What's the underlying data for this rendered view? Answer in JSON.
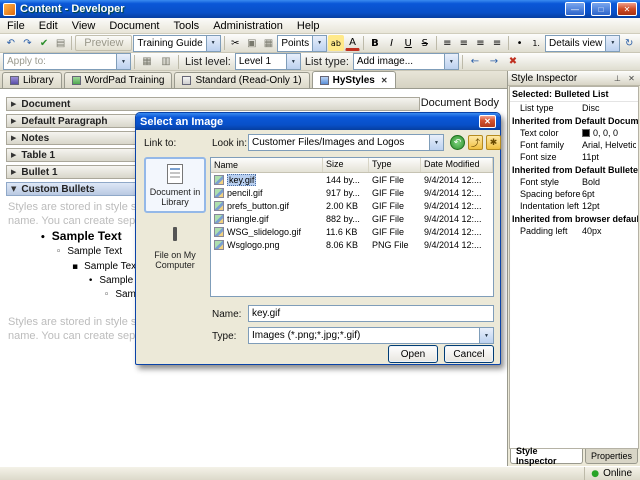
{
  "window": {
    "title": "Content - Developer",
    "status": "Online"
  },
  "menu": [
    "File",
    "Edit",
    "View",
    "Document",
    "Tools",
    "Administration",
    "Help"
  ],
  "icons": {
    "min": "—",
    "max": "□",
    "close": "✕",
    "undo": "↶",
    "redo": "↷",
    "check": "✔",
    "print": "▤",
    "cut": "✂",
    "copy": "▣",
    "paste": "▦",
    "highlight": "ab",
    "fontcolor": "A",
    "bold": "B",
    "italic": "I",
    "underline": "U",
    "strike": "S",
    "align": "≡",
    "bullets": "•",
    "numbering": "1.",
    "refresh": "↻",
    "image": "▦",
    "table": "▥",
    "outdent": "←",
    "indent": "→",
    "clear": "✖",
    "dropdown": "▼",
    "back": "↶",
    "folder_up": "⤴",
    "new_folder": "✱",
    "pin": "⊥",
    "arrow_right": "▶",
    "arrow_down": "▼",
    "dot": "●"
  },
  "toolbar": {
    "preview": "Preview",
    "style_combo": "Training Guide",
    "size_combo": "Points",
    "view_combo": "Details view",
    "apply_to": "Apply to:",
    "list_level_label": "List level:",
    "list_level": "Level 1",
    "list_type_label": "List type:",
    "list_type": "Add image..."
  },
  "tabs": [
    "Library",
    "WordPad Training",
    "Standard (Read-Only 1)",
    "HyStyles"
  ],
  "content": {
    "doc_body": "- Document Body",
    "sections": [
      "Document",
      "Default Paragraph",
      "Notes",
      "Table 1",
      "Bullet 1",
      "Custom Bullets"
    ],
    "gray1": "Styles are stored in style she",
    "gray2": "name. You can create separa",
    "markers": [
      "•",
      "◦",
      "▪",
      "•",
      "◦"
    ],
    "samples": [
      "Sample Text",
      "Sample Text",
      "Sample Text",
      "Sample Text",
      "Sample Text"
    ]
  },
  "dialog": {
    "title": "Select an Image",
    "link_to": "Link to:",
    "look_in_label": "Look in:",
    "look_in_value": "Customer Files/Images and Logos",
    "doc_in_library": "Document in Library",
    "file_on_computer": "File on My Computer",
    "columns": [
      "Name",
      "Size",
      "Type",
      "Date Modified"
    ],
    "files": [
      {
        "name": "key.gif",
        "size": "144 by...",
        "type": "GIF File",
        "modified": "9/4/2014 12:..."
      },
      {
        "name": "pencil.gif",
        "size": "917 by...",
        "type": "GIF File",
        "modified": "9/4/2014 12:..."
      },
      {
        "name": "prefs_button.gif",
        "size": "2.00 KB",
        "type": "GIF File",
        "modified": "9/4/2014 12:..."
      },
      {
        "name": "triangle.gif",
        "size": "882 by...",
        "type": "GIF File",
        "modified": "9/4/2014 12:..."
      },
      {
        "name": "WSG_slidelogo.gif",
        "size": "11.6 KB",
        "type": "GIF File",
        "modified": "9/4/2014 12:..."
      },
      {
        "name": "Wsglogo.png",
        "size": "8.06 KB",
        "type": "PNG File",
        "modified": "9/4/2014 12:..."
      }
    ],
    "name_label": "Name:",
    "name_value": "key.gif",
    "type_label": "Type:",
    "type_value": "Images (*.png;*.jpg;*.gif)",
    "open": "Open",
    "cancel": "Cancel"
  },
  "inspector": {
    "title": "Style Inspector",
    "selected": "Selected: Bulleted List",
    "list_type_label": "List type",
    "list_type_value": "Disc",
    "g1": "Inherited from Default Document",
    "text_color_label": "Text color",
    "text_color_value": "0, 0, 0",
    "font_family_label": "Font family",
    "font_family_value": "Arial, Helvetica,",
    "font_size_label": "Font size",
    "font_size_value": "11pt",
    "g2": "Inherited from Default Bulleted Li",
    "font_style_label": "Font style",
    "font_style_value": "Bold",
    "spacing_label": "Spacing before",
    "spacing_value": "6pt",
    "indent_label": "Indentation left",
    "indent_value": "12pt",
    "g3": "Inherited from browser defaults",
    "padding_label": "Padding left",
    "padding_value": "40px",
    "tab1": "Style Inspector",
    "tab2": "Properties",
    "text_color_hex": "#000000"
  }
}
